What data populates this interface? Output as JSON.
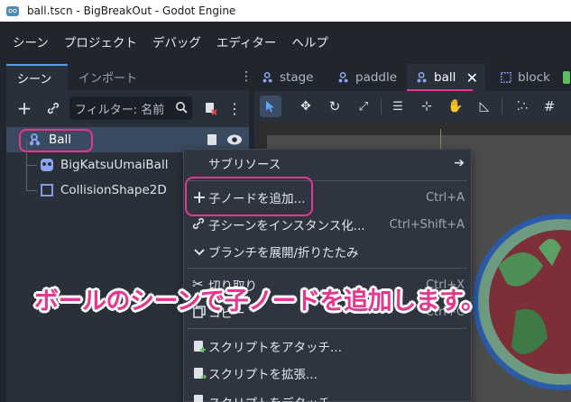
{
  "window": {
    "title": "ball.tscn - BigBreakOut - Godot Engine"
  },
  "menubar": {
    "items": [
      "シーン",
      "プロジェクト",
      "デバッグ",
      "エディター",
      "ヘルプ"
    ]
  },
  "scene_dock": {
    "tabs": [
      "シーン",
      "インポート"
    ],
    "filter_placeholder": "フィルター: 名前",
    "tree": [
      {
        "label": "Ball"
      },
      {
        "label": "BigKatsuUmaiBall"
      },
      {
        "label": "CollisionShape2D"
      }
    ]
  },
  "editor_tabs": [
    "stage",
    "paddle",
    "ball",
    "block"
  ],
  "context_menu": {
    "items": [
      {
        "label": "サブリソース",
        "shortcut": ""
      },
      {
        "label": "子ノードを追加...",
        "shortcut": "Ctrl+A"
      },
      {
        "label": "子シーンをインスタンス化...",
        "shortcut": "Ctrl+Shift+A"
      },
      {
        "label": "ブランチを展開/折りたたみ",
        "shortcut": ""
      },
      {
        "label": "切り取り",
        "shortcut": "Ctrl+X"
      },
      {
        "label": "コピー",
        "shortcut": "Ctrl+C"
      },
      {
        "label": "スクリプトをアタッチ...",
        "shortcut": ""
      },
      {
        "label": "スクリプトを拡張...",
        "shortcut": ""
      },
      {
        "label": "スクリプトをデタッチ",
        "shortcut": ""
      }
    ]
  },
  "annotation": "ボールのシーンで子ノードを追加します。",
  "colors": {
    "highlight": "#e8368f",
    "accent": "#4aa5ff",
    "background": "#21262e"
  }
}
